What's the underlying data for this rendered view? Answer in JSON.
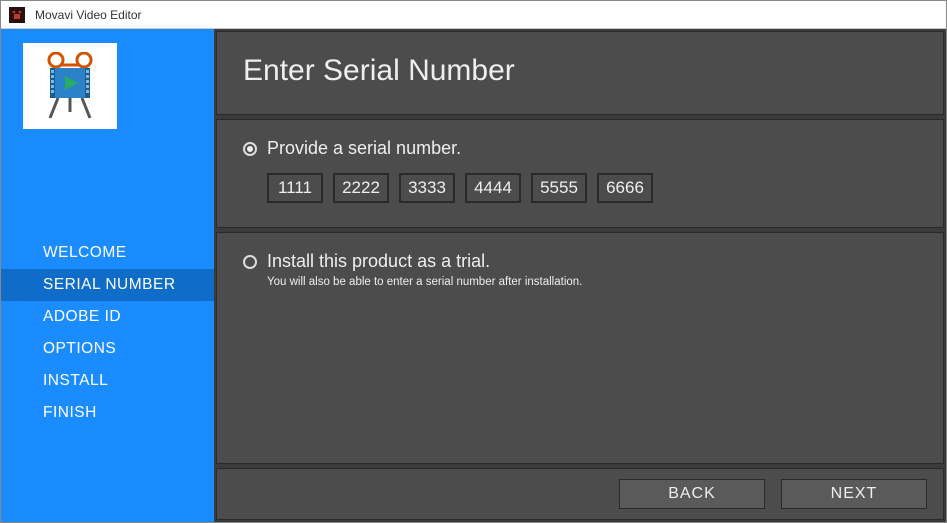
{
  "titlebar": {
    "app_title": "Movavi Video Editor"
  },
  "sidebar": {
    "items": [
      {
        "label": "WELCOME",
        "active": false
      },
      {
        "label": "SERIAL NUMBER",
        "active": true
      },
      {
        "label": "ADOBE ID",
        "active": false
      },
      {
        "label": "OPTIONS",
        "active": false
      },
      {
        "label": "INSTALL",
        "active": false
      },
      {
        "label": "FINISH",
        "active": false
      }
    ]
  },
  "header": {
    "title": "Enter Serial Number"
  },
  "option_serial": {
    "label": "Provide a serial number.",
    "selected": true,
    "fields": [
      "1111",
      "2222",
      "3333",
      "4444",
      "5555",
      "6666"
    ]
  },
  "option_trial": {
    "label": "Install this product as a trial.",
    "sub": "You will also be able to enter a serial number after installation.",
    "selected": false
  },
  "footer": {
    "back": "BACK",
    "next": "NEXT"
  }
}
